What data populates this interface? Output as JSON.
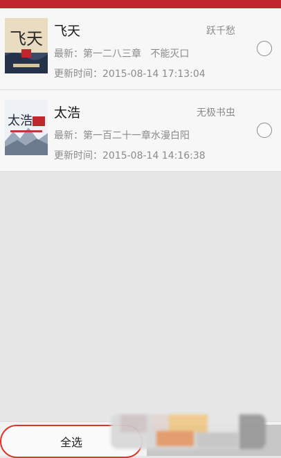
{
  "books": [
    {
      "title": "飞天",
      "author": "跃千愁",
      "latest": "最新：第一二八三章   不能灭口",
      "updated": "更新时间：2015-08-14 17:13:04",
      "cover_text": "飞天"
    },
    {
      "title": "太浩",
      "author": "无极书虫",
      "latest": "最新：第一百二十一章水漫白阳",
      "updated": "更新时间：2015-08-14 14:16:38",
      "cover_text": "太浩"
    }
  ],
  "footer": {
    "select_all_label": "全选"
  },
  "colors": {
    "brand_red": "#c0272d",
    "text_gray": "#8a8a8a"
  }
}
